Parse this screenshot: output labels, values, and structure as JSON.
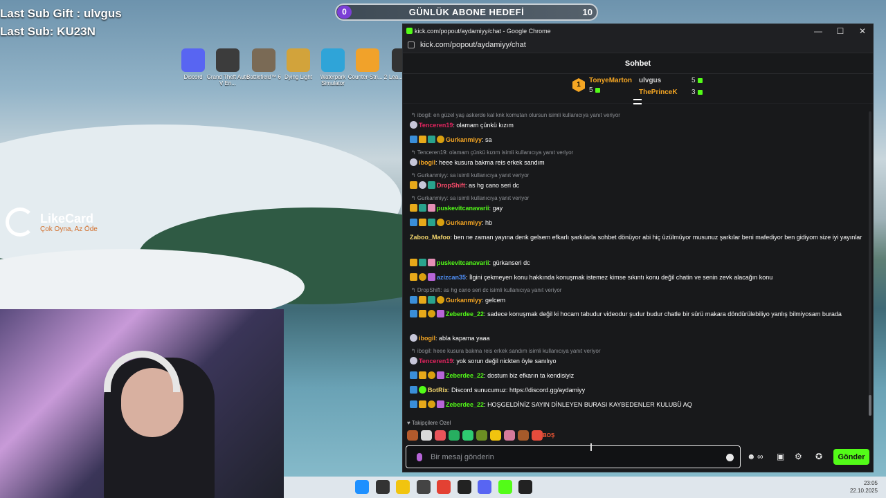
{
  "overlay": {
    "last_sub_gift": "Last Sub Gift : ulvgus",
    "last_sub": "Last Sub: KU23N",
    "goal": {
      "start": "0",
      "title": "GÜNLÜK ABONE HEDEFİ",
      "target": "10"
    },
    "likecard": {
      "name": "LikeCard",
      "tagline": "Çok Oyna, Az Öde"
    }
  },
  "desktop_icons": [
    {
      "label": "Discord",
      "color": "#5865f2"
    },
    {
      "label": "Grand Theft Auto V En...",
      "color": "#3c3c3c"
    },
    {
      "label": "Battlefield™ 6",
      "color": "#7a6a55"
    },
    {
      "label": "Dying Light",
      "color": "#d2a33b"
    },
    {
      "label": "Waterpark Simulator",
      "color": "#2fa4d8"
    },
    {
      "label": "Counter-Stri... 2",
      "color": "#f1a22a"
    },
    {
      "label": "Lea... Leg...",
      "color": "#333333"
    }
  ],
  "browser": {
    "title": "kick.com/popout/aydamiyy/chat - Google Chrome",
    "url": "kick.com/popout/aydamiyy/chat",
    "controls": {
      "minimize": "—",
      "maximize": "☐",
      "close": "✕"
    }
  },
  "chat": {
    "header": "Sohbet",
    "top_gifters": [
      {
        "rank": "1",
        "name": "TonyeMarton",
        "count": "5",
        "color": "#f5a623"
      },
      {
        "rank": "2",
        "name": "ulvgus",
        "count": "5",
        "color": "#d0d0d0"
      },
      {
        "rank": "3",
        "name": "ThePrinceK",
        "count": "3",
        "color": "#f5a623"
      }
    ],
    "messages": [
      {
        "reply": "ibogil: en güzel yaş askerde kal knk komutan olursun isimli kullanıcıya yanıt veriyor",
        "badges": [
          "moon"
        ],
        "user": "Tenceren19",
        "color": "#e0245e",
        "text": "olamam çünkü kızım"
      },
      {
        "reply": "",
        "badges": [
          "sub",
          "crown",
          "gift",
          "ggg"
        ],
        "user": "Gurkanmiyy",
        "color": "#f5a623",
        "text": "sa"
      },
      {
        "reply": "Tenceren19: olamam çünkü kızım isimli kullanıcıya yanıt veriyor",
        "badges": [
          "moon"
        ],
        "user": "ibogil",
        "color": "#f5a623",
        "text": "heee kusura bakma reis erkek sandım"
      },
      {
        "reply": "Gurkanmiyy: sa isimli kullanıcıya yanıt veriyor",
        "badges": [
          "crown",
          "moon",
          "gift"
        ],
        "user": "DropShift",
        "color": "#ff4d6d",
        "text": "as hg cano seri dc"
      },
      {
        "reply": "Gurkanmiyy: sa isimli kullanıcıya yanıt veriyor",
        "badges": [
          "crown",
          "gift",
          "pink"
        ],
        "user": "puskevitcanavarii",
        "color": "#53fc18",
        "text": "gay"
      },
      {
        "reply": "",
        "badges": [
          "sub",
          "crown",
          "gift",
          "ggg"
        ],
        "user": "Gurkanmiyy",
        "color": "#f5a623",
        "text": "hb"
      },
      {
        "reply": "",
        "badges": [],
        "user": "Zaboo_Mafoo",
        "color": "#f5d76e",
        "text": "ben ne zaman yayına denk gelsem efkarlı şarkılarla sohbet dönüyor abi hiç üzülmüyor musunuz şarkılar beni mafediyor ben gidiyom size iyi yayınlar"
      },
      {
        "reply": "",
        "badges": [
          "crown",
          "gift",
          "pink"
        ],
        "user": "puskevitcanavarii",
        "color": "#53fc18",
        "text": "gürkanseri dc"
      },
      {
        "reply": "",
        "badges": [
          "crown",
          "ggg",
          "vip"
        ],
        "user": "azizcan35",
        "color": "#4f8ff7",
        "text": "İlgini çekmeyen konu hakkında konuşmak istemez kimse sıkıntı konu değil chatin ve senin zevk alacağın konu"
      },
      {
        "reply": "DropShift: as hg cano seri dc isimli kullanıcıya yanıt veriyor",
        "badges": [
          "sub",
          "crown",
          "gift",
          "ggg"
        ],
        "user": "Gurkanmiyy",
        "color": "#f5a623",
        "text": "gelcem"
      },
      {
        "reply": "",
        "badges": [
          "sub",
          "crown",
          "ggg",
          "vip"
        ],
        "user": "Zeberdee_22",
        "color": "#53fc18",
        "text": "sadece konuşmak değil ki hocam tabudur videodur şudur budur chatle bir sürü makara döndürülebiliyo yanlış bilmiyosam burada"
      },
      {
        "reply": "",
        "badges": [
          "moon"
        ],
        "user": "ibogil",
        "color": "#f5a623",
        "text": "abla kapama yaaa"
      },
      {
        "reply": "ibogil: heee kusura bakma reis erkek sandım isimli kullanıcıya yanıt veriyor",
        "badges": [
          "moon"
        ],
        "user": "Tenceren19",
        "color": "#e0245e",
        "text": "yok sorun değil nickten öyle sanılıyo"
      },
      {
        "reply": "",
        "badges": [
          "sub",
          "crown",
          "ggg",
          "vip"
        ],
        "user": "Zeberdee_22",
        "color": "#53fc18",
        "text": "dostum biz efkarın ta kendisiyiz"
      },
      {
        "reply": "",
        "badges": [
          "sub",
          "bot"
        ],
        "user": "BotRix",
        "color": "#f5d76e",
        "text": "Discord sunucumuz: https://discord.gg/aydamiyy"
      },
      {
        "reply": "",
        "badges": [
          "sub",
          "crown",
          "ggg",
          "vip"
        ],
        "user": "Zeberdee_22",
        "color": "#53fc18",
        "text": "HOŞGELDİNİZ SAYIN DİNLEYEN BURASI KAYBEDENLER KULUBÜ AQ"
      }
    ],
    "emotes_label": "♥ Takipçilere Özel",
    "emote_colors": [
      "#b35a2c",
      "#d9d9d9",
      "#e8545a",
      "#27ae60",
      "#2ecc71",
      "#6b8e23",
      "#f1c40f",
      "#d57a9a",
      "#a55a2a",
      "#e74c3c"
    ],
    "emote_last_text": "BOŞ",
    "composer_placeholder": "Bir mesaj gönderin",
    "tools": {
      "emoji": "☻",
      "infinity": "∞",
      "gift": "▣",
      "settings": "⚙",
      "badge": "✪"
    },
    "send_label": "Gönder"
  },
  "taskbar": {
    "time": "23:05",
    "date": "22.10.2025",
    "apps": [
      "#1e90ff",
      "#333333",
      "#f1c40f",
      "#444444",
      "#e34133",
      "#222222",
      "#5865f2",
      "#53fc18",
      "#222222"
    ]
  }
}
